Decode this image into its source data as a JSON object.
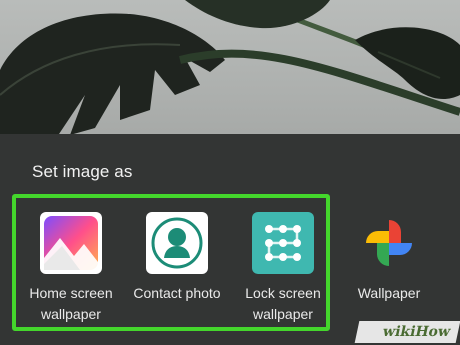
{
  "sheet": {
    "title": "Set image as"
  },
  "apps": [
    {
      "id": "home",
      "label": "Home screen wallpaper",
      "icon": "gallery-icon"
    },
    {
      "id": "contact",
      "label": "Contact photo",
      "icon": "contact-person-icon"
    },
    {
      "id": "lock",
      "label": "Lock screen wallpaper",
      "icon": "pattern-lock-icon"
    },
    {
      "id": "wallpaper",
      "label": "Wallpaper",
      "icon": "pinwheel-icon"
    }
  ],
  "watermark": {
    "text": "wikiHow"
  },
  "colors": {
    "highlight": "#44d62c",
    "sheet": "#333534"
  }
}
